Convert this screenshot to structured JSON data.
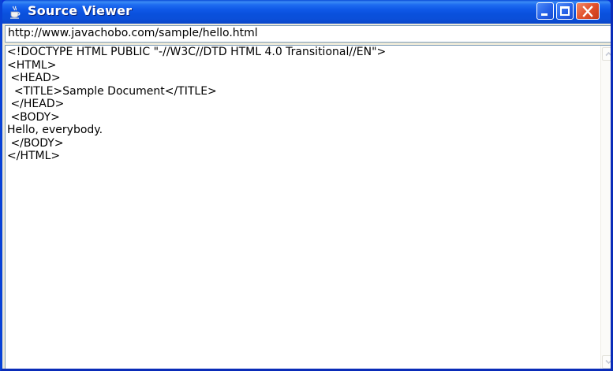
{
  "window": {
    "title": "Source Viewer",
    "title_icon": "java-cup-icon",
    "controls": {
      "minimize": "minimize-icon",
      "maximize": "maximize-icon",
      "close": "close-icon"
    },
    "colors": {
      "titlebar": "#0a50dc",
      "close_button": "#e2522c",
      "client_background": "#ece9d8"
    }
  },
  "url_field": {
    "value": "http://www.javachobo.com/sample/hello.html"
  },
  "source": {
    "lines": [
      "<!DOCTYPE HTML PUBLIC \"-//W3C//DTD HTML 4.0 Transitional//EN\">",
      "<HTML>",
      " <HEAD>",
      "  <TITLE>Sample Document</TITLE>",
      " </HEAD>",
      " <BODY>",
      "Hello, everybody.",
      " </BODY>",
      "</HTML>"
    ]
  },
  "scrollbar": {
    "up_icon": "scroll-up-arrow-icon",
    "down_icon": "scroll-down-arrow-icon"
  }
}
